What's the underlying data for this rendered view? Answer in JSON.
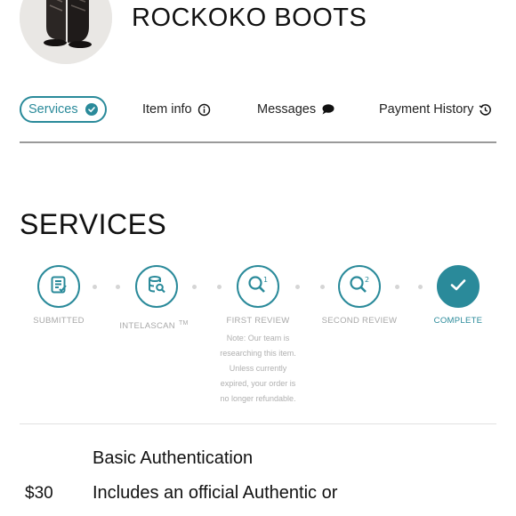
{
  "item": {
    "title": "ROCKOKO BOOTS",
    "image_icon": "boots-photo"
  },
  "tabs": [
    {
      "label": "Services",
      "icon": "check-circle-icon",
      "active": true
    },
    {
      "label": "Item info",
      "icon": "info-icon",
      "active": false
    },
    {
      "label": "Messages",
      "icon": "chat-bubble-icon",
      "active": false
    },
    {
      "label": "Payment History",
      "icon": "history-icon",
      "active": false
    }
  ],
  "section": {
    "title": "SERVICES"
  },
  "steps": [
    {
      "label": "SUBMITTED",
      "icon": "document-icon",
      "state": "done"
    },
    {
      "label": "INTELASCAN",
      "tm": "TM",
      "icon": "database-search-icon",
      "state": "done"
    },
    {
      "label": "FIRST REVIEW",
      "icon": "search-1-icon",
      "state": "done"
    },
    {
      "label": "SECOND REVIEW",
      "icon": "search-2-icon",
      "state": "done"
    },
    {
      "label": "COMPLETE",
      "icon": "check-icon",
      "state": "current"
    }
  ],
  "review_note": {
    "lines": [
      "Note: Our team is",
      "researching this item.",
      "Unless currently",
      "expired, your order is",
      "no longer refundable."
    ]
  },
  "service": {
    "name": "Basic Authentication",
    "price": "$30",
    "description": "Includes an official Authentic or"
  },
  "colors": {
    "accent": "#2a8a9a",
    "muted": "#a8a8a8"
  }
}
